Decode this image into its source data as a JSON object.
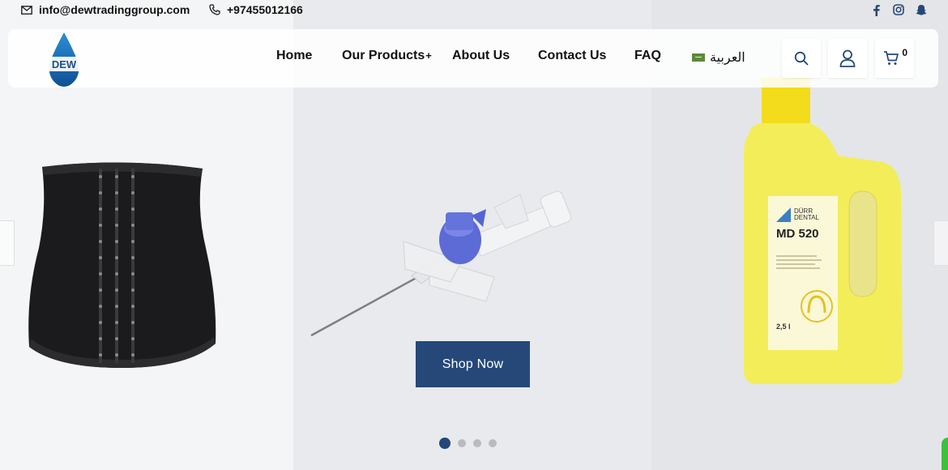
{
  "topbar": {
    "email": "info@dewtradinggroup.com",
    "phone": "+97455012166",
    "socials": [
      "facebook-icon",
      "instagram-icon",
      "snapchat-icon"
    ]
  },
  "header": {
    "logo_text": "DEW",
    "nav": {
      "home": "Home",
      "products": "Our Products",
      "products_plus": "+",
      "about": "About Us",
      "contact": "Contact Us",
      "faq": "FAQ",
      "language": "العربية"
    },
    "cart_count": "0"
  },
  "bottle_label": {
    "brand_line1": "DÜRR",
    "brand_line2": "DENTAL",
    "product": "MD 520",
    "volume": "2,5 l"
  },
  "hero": {
    "cta": "Shop Now",
    "slides": 4,
    "active_slide": 1
  },
  "colors": {
    "accent": "#254879",
    "logo_blue": "#1f6fb5"
  }
}
